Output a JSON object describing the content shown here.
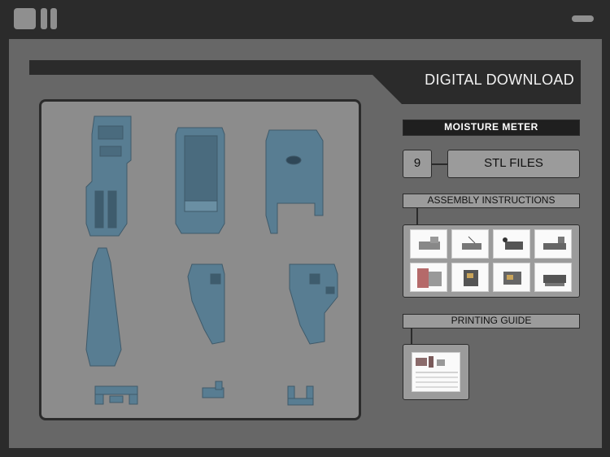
{
  "header": {
    "title": "DIGITAL DOWNLOAD"
  },
  "product": {
    "name": "MOISTURE METER",
    "file_count": "9",
    "file_type_label": "STL FILES"
  },
  "sections": {
    "assembly": {
      "label": "ASSEMBLY INSTRUCTIONS",
      "thumbnail_count": 8
    },
    "printing": {
      "label": "PRINTING GUIDE",
      "thumbnail_count": 1
    }
  },
  "colors": {
    "background": "#2b2b2b",
    "panel": "#676767",
    "render_bg": "#8c8c8c",
    "part": "#587d92",
    "label_bg": "#9b9b9b"
  }
}
